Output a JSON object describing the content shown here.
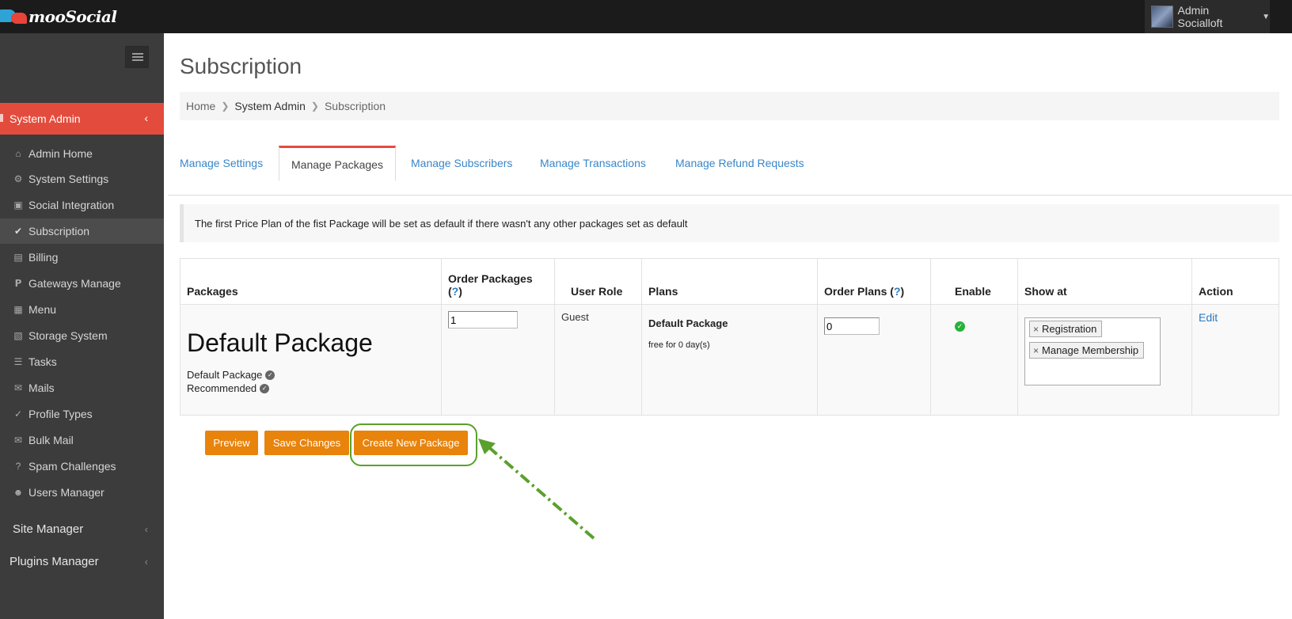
{
  "app": {
    "logo_text": "mooSocial",
    "user_name": "Admin Socialloft"
  },
  "sidebar": {
    "section_title": "System Admin",
    "items": [
      {
        "label": "Admin Home",
        "icon": "home-icon"
      },
      {
        "label": "System Settings",
        "icon": "gear-icon"
      },
      {
        "label": "Social Integration",
        "icon": "share-icon"
      },
      {
        "label": "Subscription",
        "icon": "check-icon",
        "active": true
      },
      {
        "label": "Billing",
        "icon": "credit-card-icon"
      },
      {
        "label": "Gateways Manage",
        "icon": "paypal-icon"
      },
      {
        "label": "Menu",
        "icon": "sitemap-icon"
      },
      {
        "label": "Storage System",
        "icon": "file-icon"
      },
      {
        "label": "Tasks",
        "icon": "list-icon"
      },
      {
        "label": "Mails",
        "icon": "envelope-icon"
      },
      {
        "label": "Profile Types",
        "icon": "check-circle-icon"
      },
      {
        "label": "Bulk Mail",
        "icon": "envelope-icon"
      },
      {
        "label": "Spam Challenges",
        "icon": "question-circle-icon"
      },
      {
        "label": "Users Manager",
        "icon": "user-icon"
      }
    ],
    "groups": [
      {
        "label": "Site Manager"
      },
      {
        "label": "Plugins Manager"
      }
    ]
  },
  "page": {
    "title": "Subscription",
    "breadcrumb": [
      "Home",
      "System Admin",
      "Subscription"
    ]
  },
  "tabs": [
    {
      "label": "Manage Settings"
    },
    {
      "label": "Manage Packages",
      "active": true
    },
    {
      "label": "Manage Subscribers"
    },
    {
      "label": "Manage Transactions"
    },
    {
      "label": "Manage Refund Requests"
    }
  ],
  "notice": "The first Price Plan of the fist Package will be set as default if there wasn't any other packages set as default",
  "table": {
    "headers": {
      "packages": "Packages",
      "order_packages": "Order Packages",
      "user_role": "User Role",
      "plans": "Plans",
      "order_plans": "Order Plans",
      "enable": "Enable",
      "show_at": "Show at",
      "action": "Action",
      "help_mark": "?"
    },
    "row": {
      "package_name": "Default Package",
      "flags": [
        "Default Package",
        "Recommended"
      ],
      "order_package": "1",
      "user_role": "Guest",
      "plan_name": "Default Package",
      "plan_desc": "free for 0 day(s)",
      "order_plan": "0",
      "enabled": true,
      "show_at": [
        "Registration",
        "Manage Membership"
      ],
      "action": "Edit"
    }
  },
  "buttons": {
    "preview": "Preview",
    "save": "Save Changes",
    "create": "Create New Package"
  },
  "colors": {
    "accent_red": "#e34c3d",
    "button_orange": "#e8830c",
    "link_blue": "#3a86c8",
    "annotation_green": "#5aa02c"
  }
}
